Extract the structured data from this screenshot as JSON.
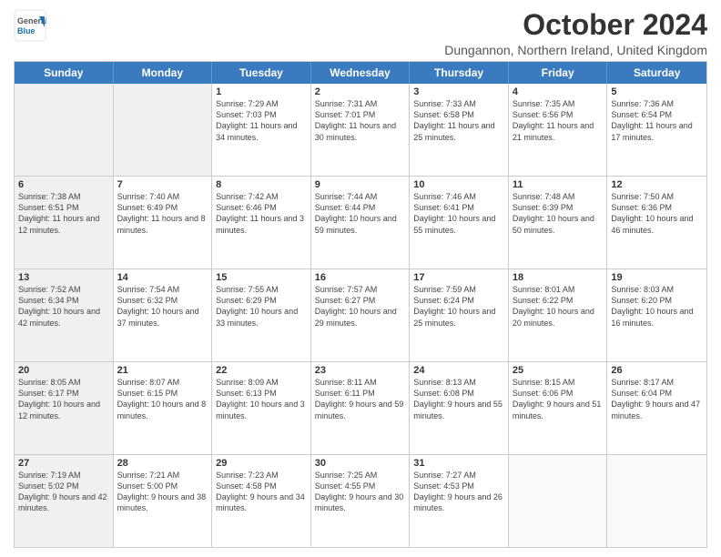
{
  "logo": {
    "general": "General",
    "blue": "Blue"
  },
  "title": "October 2024",
  "location": "Dungannon, Northern Ireland, United Kingdom",
  "days": [
    "Sunday",
    "Monday",
    "Tuesday",
    "Wednesday",
    "Thursday",
    "Friday",
    "Saturday"
  ],
  "weeks": [
    [
      {
        "day": "",
        "sunrise": "",
        "sunset": "",
        "daylight": "",
        "shaded": true
      },
      {
        "day": "",
        "sunrise": "",
        "sunset": "",
        "daylight": "",
        "shaded": true
      },
      {
        "day": "1",
        "sunrise": "Sunrise: 7:29 AM",
        "sunset": "Sunset: 7:03 PM",
        "daylight": "Daylight: 11 hours and 34 minutes.",
        "shaded": false
      },
      {
        "day": "2",
        "sunrise": "Sunrise: 7:31 AM",
        "sunset": "Sunset: 7:01 PM",
        "daylight": "Daylight: 11 hours and 30 minutes.",
        "shaded": false
      },
      {
        "day": "3",
        "sunrise": "Sunrise: 7:33 AM",
        "sunset": "Sunset: 6:58 PM",
        "daylight": "Daylight: 11 hours and 25 minutes.",
        "shaded": false
      },
      {
        "day": "4",
        "sunrise": "Sunrise: 7:35 AM",
        "sunset": "Sunset: 6:56 PM",
        "daylight": "Daylight: 11 hours and 21 minutes.",
        "shaded": false
      },
      {
        "day": "5",
        "sunrise": "Sunrise: 7:36 AM",
        "sunset": "Sunset: 6:54 PM",
        "daylight": "Daylight: 11 hours and 17 minutes.",
        "shaded": false
      }
    ],
    [
      {
        "day": "6",
        "sunrise": "Sunrise: 7:38 AM",
        "sunset": "Sunset: 6:51 PM",
        "daylight": "Daylight: 11 hours and 12 minutes.",
        "shaded": true
      },
      {
        "day": "7",
        "sunrise": "Sunrise: 7:40 AM",
        "sunset": "Sunset: 6:49 PM",
        "daylight": "Daylight: 11 hours and 8 minutes.",
        "shaded": false
      },
      {
        "day": "8",
        "sunrise": "Sunrise: 7:42 AM",
        "sunset": "Sunset: 6:46 PM",
        "daylight": "Daylight: 11 hours and 3 minutes.",
        "shaded": false
      },
      {
        "day": "9",
        "sunrise": "Sunrise: 7:44 AM",
        "sunset": "Sunset: 6:44 PM",
        "daylight": "Daylight: 10 hours and 59 minutes.",
        "shaded": false
      },
      {
        "day": "10",
        "sunrise": "Sunrise: 7:46 AM",
        "sunset": "Sunset: 6:41 PM",
        "daylight": "Daylight: 10 hours and 55 minutes.",
        "shaded": false
      },
      {
        "day": "11",
        "sunrise": "Sunrise: 7:48 AM",
        "sunset": "Sunset: 6:39 PM",
        "daylight": "Daylight: 10 hours and 50 minutes.",
        "shaded": false
      },
      {
        "day": "12",
        "sunrise": "Sunrise: 7:50 AM",
        "sunset": "Sunset: 6:36 PM",
        "daylight": "Daylight: 10 hours and 46 minutes.",
        "shaded": false
      }
    ],
    [
      {
        "day": "13",
        "sunrise": "Sunrise: 7:52 AM",
        "sunset": "Sunset: 6:34 PM",
        "daylight": "Daylight: 10 hours and 42 minutes.",
        "shaded": true
      },
      {
        "day": "14",
        "sunrise": "Sunrise: 7:54 AM",
        "sunset": "Sunset: 6:32 PM",
        "daylight": "Daylight: 10 hours and 37 minutes.",
        "shaded": false
      },
      {
        "day": "15",
        "sunrise": "Sunrise: 7:55 AM",
        "sunset": "Sunset: 6:29 PM",
        "daylight": "Daylight: 10 hours and 33 minutes.",
        "shaded": false
      },
      {
        "day": "16",
        "sunrise": "Sunrise: 7:57 AM",
        "sunset": "Sunset: 6:27 PM",
        "daylight": "Daylight: 10 hours and 29 minutes.",
        "shaded": false
      },
      {
        "day": "17",
        "sunrise": "Sunrise: 7:59 AM",
        "sunset": "Sunset: 6:24 PM",
        "daylight": "Daylight: 10 hours and 25 minutes.",
        "shaded": false
      },
      {
        "day": "18",
        "sunrise": "Sunrise: 8:01 AM",
        "sunset": "Sunset: 6:22 PM",
        "daylight": "Daylight: 10 hours and 20 minutes.",
        "shaded": false
      },
      {
        "day": "19",
        "sunrise": "Sunrise: 8:03 AM",
        "sunset": "Sunset: 6:20 PM",
        "daylight": "Daylight: 10 hours and 16 minutes.",
        "shaded": false
      }
    ],
    [
      {
        "day": "20",
        "sunrise": "Sunrise: 8:05 AM",
        "sunset": "Sunset: 6:17 PM",
        "daylight": "Daylight: 10 hours and 12 minutes.",
        "shaded": true
      },
      {
        "day": "21",
        "sunrise": "Sunrise: 8:07 AM",
        "sunset": "Sunset: 6:15 PM",
        "daylight": "Daylight: 10 hours and 8 minutes.",
        "shaded": false
      },
      {
        "day": "22",
        "sunrise": "Sunrise: 8:09 AM",
        "sunset": "Sunset: 6:13 PM",
        "daylight": "Daylight: 10 hours and 3 minutes.",
        "shaded": false
      },
      {
        "day": "23",
        "sunrise": "Sunrise: 8:11 AM",
        "sunset": "Sunset: 6:11 PM",
        "daylight": "Daylight: 9 hours and 59 minutes.",
        "shaded": false
      },
      {
        "day": "24",
        "sunrise": "Sunrise: 8:13 AM",
        "sunset": "Sunset: 6:08 PM",
        "daylight": "Daylight: 9 hours and 55 minutes.",
        "shaded": false
      },
      {
        "day": "25",
        "sunrise": "Sunrise: 8:15 AM",
        "sunset": "Sunset: 6:06 PM",
        "daylight": "Daylight: 9 hours and 51 minutes.",
        "shaded": false
      },
      {
        "day": "26",
        "sunrise": "Sunrise: 8:17 AM",
        "sunset": "Sunset: 6:04 PM",
        "daylight": "Daylight: 9 hours and 47 minutes.",
        "shaded": false
      }
    ],
    [
      {
        "day": "27",
        "sunrise": "Sunrise: 7:19 AM",
        "sunset": "Sunset: 5:02 PM",
        "daylight": "Daylight: 9 hours and 42 minutes.",
        "shaded": true
      },
      {
        "day": "28",
        "sunrise": "Sunrise: 7:21 AM",
        "sunset": "Sunset: 5:00 PM",
        "daylight": "Daylight: 9 hours and 38 minutes.",
        "shaded": false
      },
      {
        "day": "29",
        "sunrise": "Sunrise: 7:23 AM",
        "sunset": "Sunset: 4:58 PM",
        "daylight": "Daylight: 9 hours and 34 minutes.",
        "shaded": false
      },
      {
        "day": "30",
        "sunrise": "Sunrise: 7:25 AM",
        "sunset": "Sunset: 4:55 PM",
        "daylight": "Daylight: 9 hours and 30 minutes.",
        "shaded": false
      },
      {
        "day": "31",
        "sunrise": "Sunrise: 7:27 AM",
        "sunset": "Sunset: 4:53 PM",
        "daylight": "Daylight: 9 hours and 26 minutes.",
        "shaded": false
      },
      {
        "day": "",
        "sunrise": "",
        "sunset": "",
        "daylight": "",
        "shaded": false
      },
      {
        "day": "",
        "sunrise": "",
        "sunset": "",
        "daylight": "",
        "shaded": false
      }
    ]
  ]
}
